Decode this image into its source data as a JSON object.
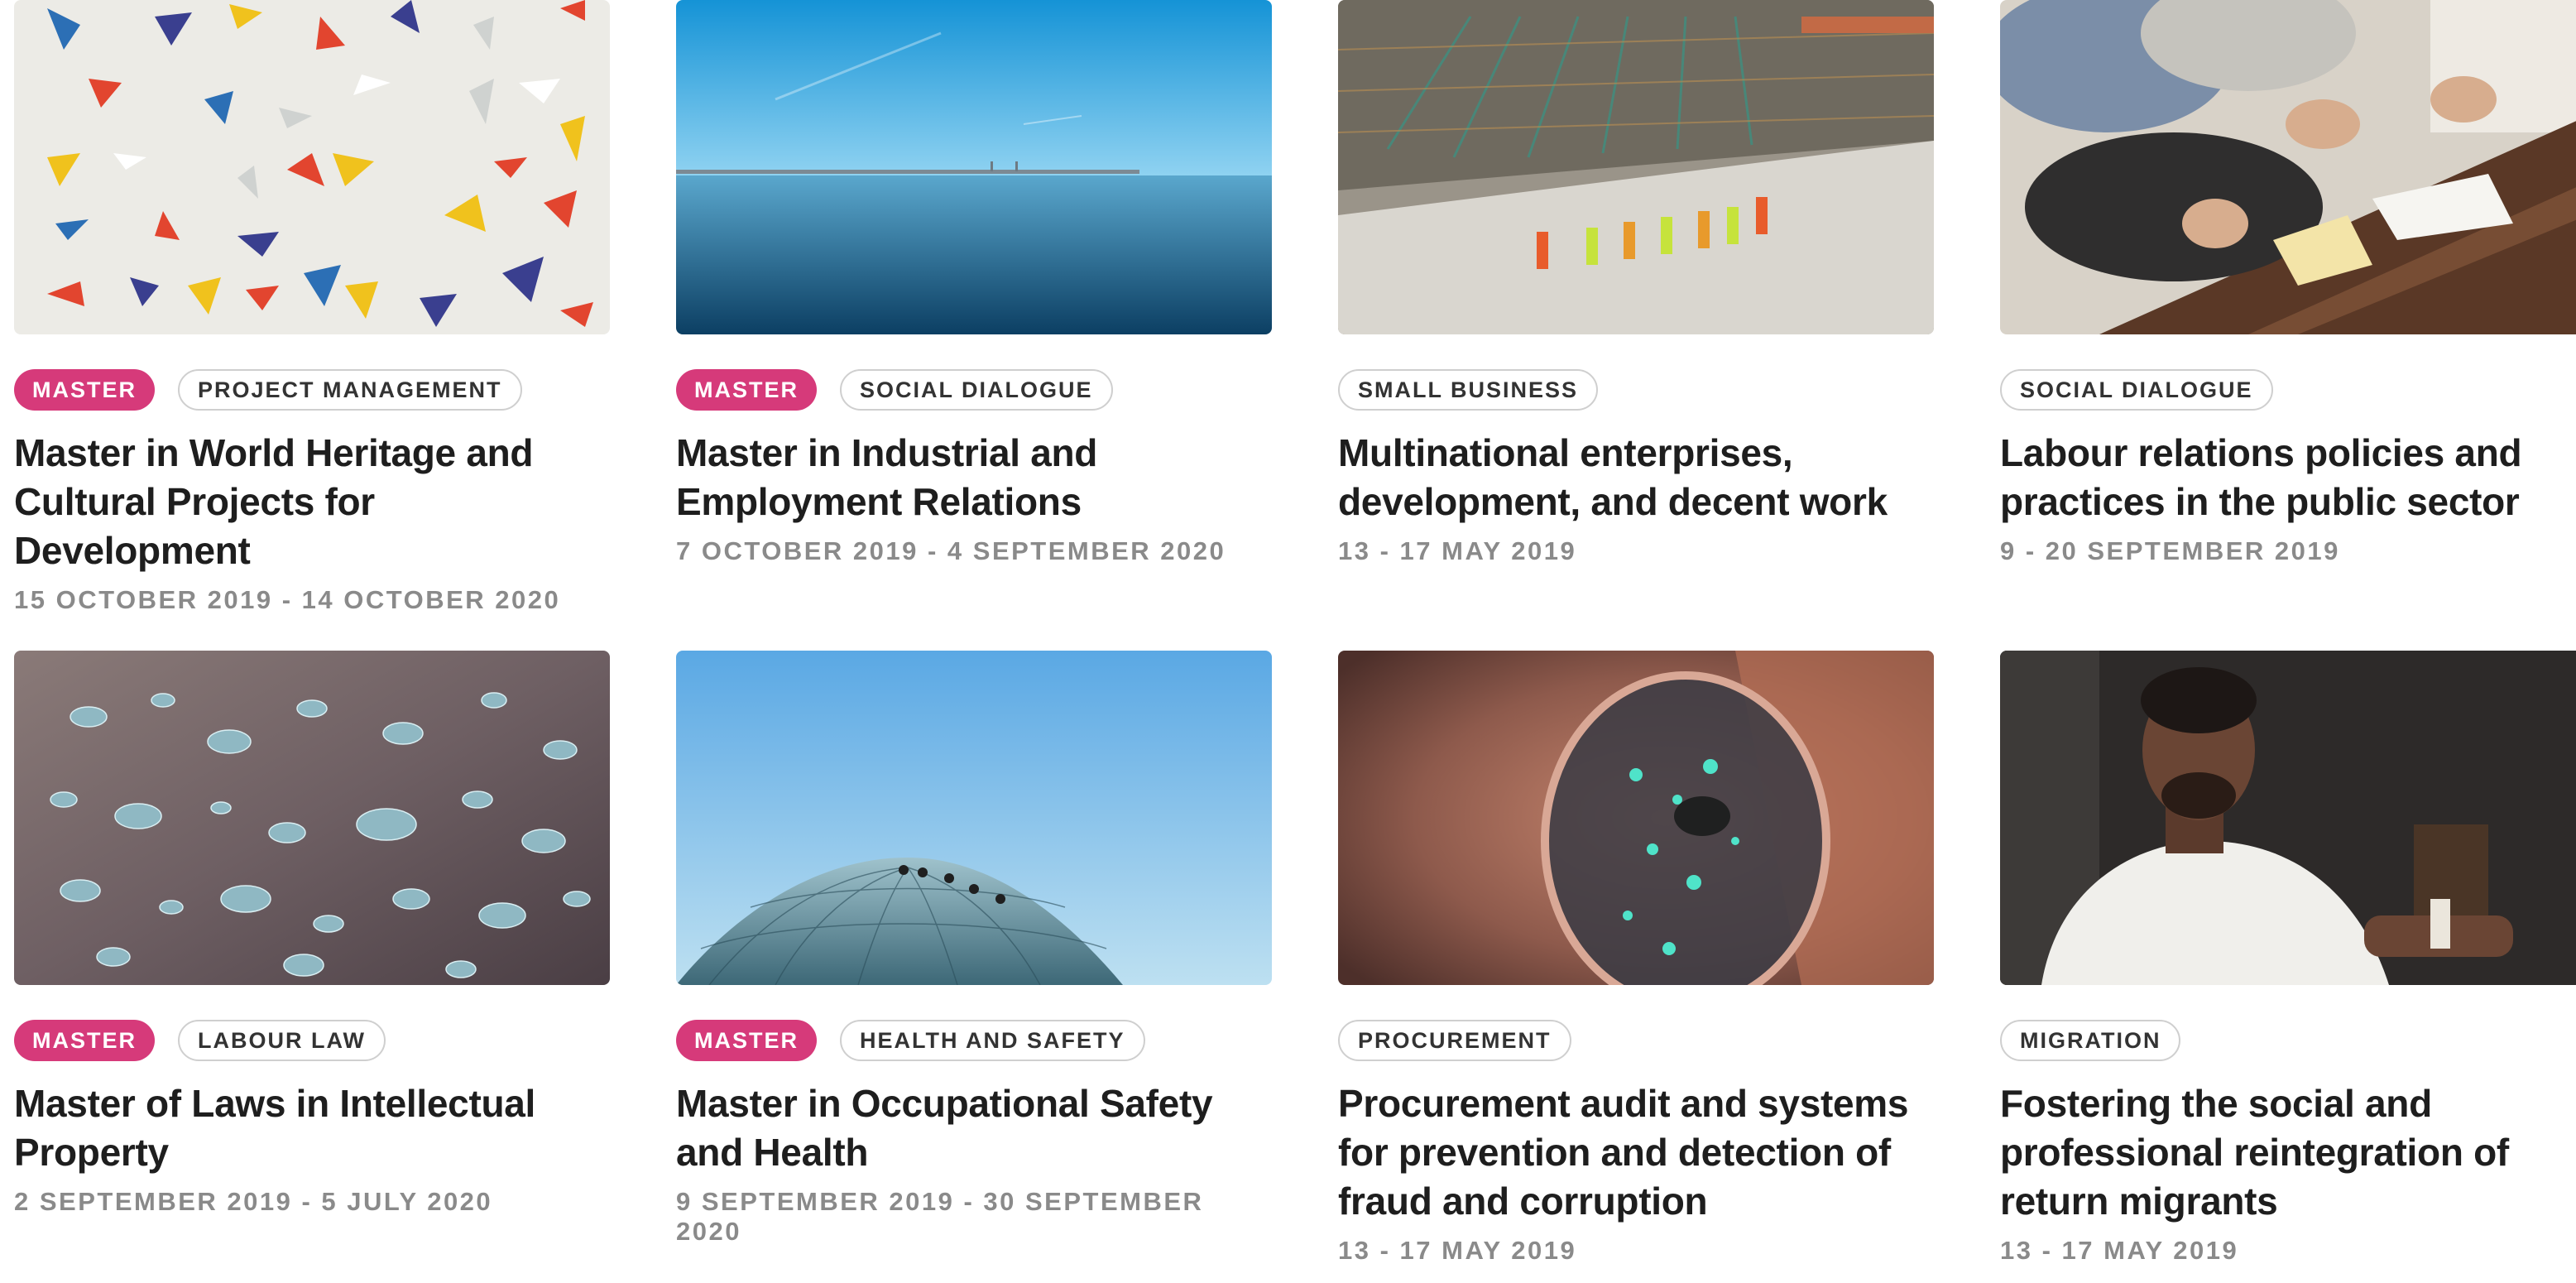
{
  "courses": [
    {
      "image": "colorful-triangles-photo",
      "tags": [
        "MASTER",
        "PROJECT MANAGEMENT"
      ],
      "title": "Master in World Heritage and Cultural Projects for Development",
      "dates": "15 OCTOBER 2019 - 14 OCTOBER 2020"
    },
    {
      "image": "sea-bridge-photo",
      "tags": [
        "MASTER",
        "SOCIAL DIALOGUE"
      ],
      "title": "Master in Industrial and Employment Relations",
      "dates": "7 OCTOBER 2019 - 4 SEPTEMBER 2020"
    },
    {
      "image": "construction-site-photo",
      "tags": [
        "SMALL BUSINESS"
      ],
      "title": "Multinational enterprises, development, and decent work",
      "dates": "13 - 17 MAY 2019"
    },
    {
      "image": "meeting-table-photo",
      "tags": [
        "SOCIAL DIALOGUE"
      ],
      "title": "Labour relations policies and practices in the public sector",
      "dates": "9 - 20 SEPTEMBER 2019"
    },
    {
      "image": "water-drops-photo",
      "tags": [
        "MASTER",
        "LABOUR LAW"
      ],
      "title": "Master of Laws in Intellectual Property",
      "dates": "2 SEPTEMBER 2019 - 5 JULY 2020"
    },
    {
      "image": "dome-climbers-photo",
      "tags": [
        "MASTER",
        "HEALTH AND SAFETY"
      ],
      "title": "Master in Occupational Safety and Health",
      "dates": "9 SEPTEMBER 2019 - 30 SEPTEMBER 2020"
    },
    {
      "image": "glasses-reflection-photo",
      "tags": [
        "PROCUREMENT"
      ],
      "title": "Procurement audit and systems for prevention and detection of fraud and corruption",
      "dates": "13 - 17 MAY 2019"
    },
    {
      "image": "man-portrait-photo",
      "tags": [
        "MIGRATION"
      ],
      "title": "Fostering the social and professional reintegration of return migrants",
      "dates": "13 - 17 MAY 2019"
    }
  ]
}
